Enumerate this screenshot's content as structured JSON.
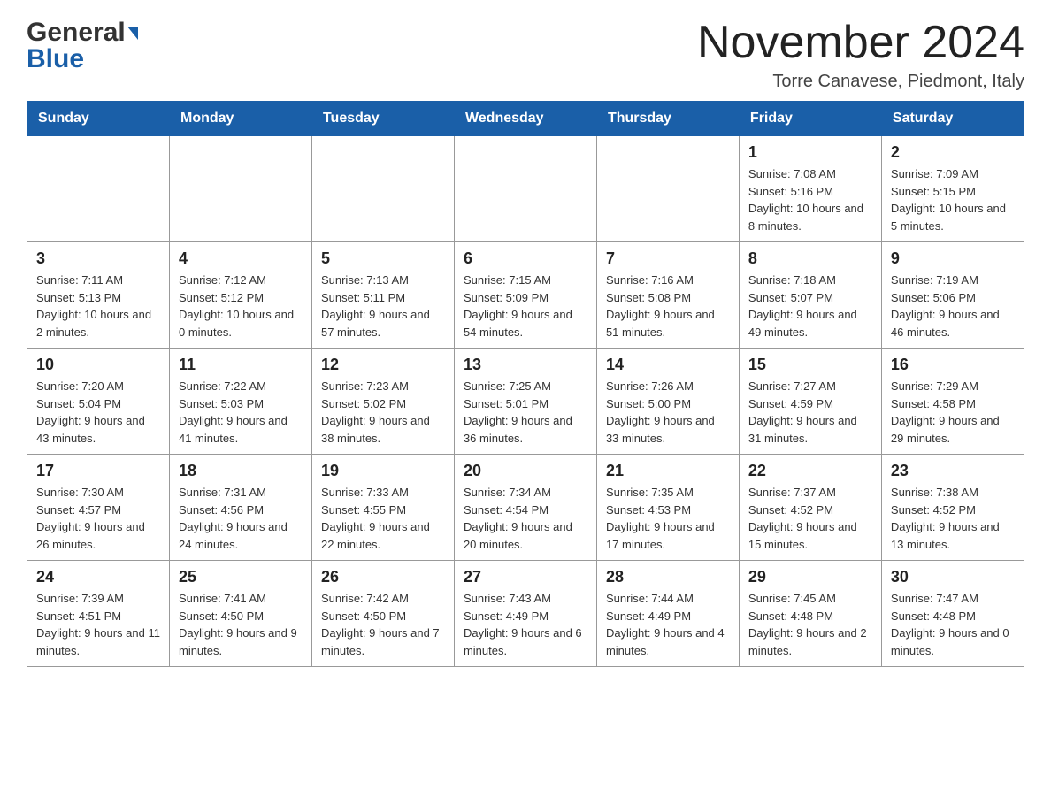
{
  "header": {
    "title": "November 2024",
    "subtitle": "Torre Canavese, Piedmont, Italy",
    "logo_line1": "General",
    "logo_line2": "Blue"
  },
  "days_of_week": [
    "Sunday",
    "Monday",
    "Tuesday",
    "Wednesday",
    "Thursday",
    "Friday",
    "Saturday"
  ],
  "weeks": [
    {
      "days": [
        {
          "number": "",
          "info": ""
        },
        {
          "number": "",
          "info": ""
        },
        {
          "number": "",
          "info": ""
        },
        {
          "number": "",
          "info": ""
        },
        {
          "number": "",
          "info": ""
        },
        {
          "number": "1",
          "info": "Sunrise: 7:08 AM\nSunset: 5:16 PM\nDaylight: 10 hours and 8 minutes."
        },
        {
          "number": "2",
          "info": "Sunrise: 7:09 AM\nSunset: 5:15 PM\nDaylight: 10 hours and 5 minutes."
        }
      ]
    },
    {
      "days": [
        {
          "number": "3",
          "info": "Sunrise: 7:11 AM\nSunset: 5:13 PM\nDaylight: 10 hours and 2 minutes."
        },
        {
          "number": "4",
          "info": "Sunrise: 7:12 AM\nSunset: 5:12 PM\nDaylight: 10 hours and 0 minutes."
        },
        {
          "number": "5",
          "info": "Sunrise: 7:13 AM\nSunset: 5:11 PM\nDaylight: 9 hours and 57 minutes."
        },
        {
          "number": "6",
          "info": "Sunrise: 7:15 AM\nSunset: 5:09 PM\nDaylight: 9 hours and 54 minutes."
        },
        {
          "number": "7",
          "info": "Sunrise: 7:16 AM\nSunset: 5:08 PM\nDaylight: 9 hours and 51 minutes."
        },
        {
          "number": "8",
          "info": "Sunrise: 7:18 AM\nSunset: 5:07 PM\nDaylight: 9 hours and 49 minutes."
        },
        {
          "number": "9",
          "info": "Sunrise: 7:19 AM\nSunset: 5:06 PM\nDaylight: 9 hours and 46 minutes."
        }
      ]
    },
    {
      "days": [
        {
          "number": "10",
          "info": "Sunrise: 7:20 AM\nSunset: 5:04 PM\nDaylight: 9 hours and 43 minutes."
        },
        {
          "number": "11",
          "info": "Sunrise: 7:22 AM\nSunset: 5:03 PM\nDaylight: 9 hours and 41 minutes."
        },
        {
          "number": "12",
          "info": "Sunrise: 7:23 AM\nSunset: 5:02 PM\nDaylight: 9 hours and 38 minutes."
        },
        {
          "number": "13",
          "info": "Sunrise: 7:25 AM\nSunset: 5:01 PM\nDaylight: 9 hours and 36 minutes."
        },
        {
          "number": "14",
          "info": "Sunrise: 7:26 AM\nSunset: 5:00 PM\nDaylight: 9 hours and 33 minutes."
        },
        {
          "number": "15",
          "info": "Sunrise: 7:27 AM\nSunset: 4:59 PM\nDaylight: 9 hours and 31 minutes."
        },
        {
          "number": "16",
          "info": "Sunrise: 7:29 AM\nSunset: 4:58 PM\nDaylight: 9 hours and 29 minutes."
        }
      ]
    },
    {
      "days": [
        {
          "number": "17",
          "info": "Sunrise: 7:30 AM\nSunset: 4:57 PM\nDaylight: 9 hours and 26 minutes."
        },
        {
          "number": "18",
          "info": "Sunrise: 7:31 AM\nSunset: 4:56 PM\nDaylight: 9 hours and 24 minutes."
        },
        {
          "number": "19",
          "info": "Sunrise: 7:33 AM\nSunset: 4:55 PM\nDaylight: 9 hours and 22 minutes."
        },
        {
          "number": "20",
          "info": "Sunrise: 7:34 AM\nSunset: 4:54 PM\nDaylight: 9 hours and 20 minutes."
        },
        {
          "number": "21",
          "info": "Sunrise: 7:35 AM\nSunset: 4:53 PM\nDaylight: 9 hours and 17 minutes."
        },
        {
          "number": "22",
          "info": "Sunrise: 7:37 AM\nSunset: 4:52 PM\nDaylight: 9 hours and 15 minutes."
        },
        {
          "number": "23",
          "info": "Sunrise: 7:38 AM\nSunset: 4:52 PM\nDaylight: 9 hours and 13 minutes."
        }
      ]
    },
    {
      "days": [
        {
          "number": "24",
          "info": "Sunrise: 7:39 AM\nSunset: 4:51 PM\nDaylight: 9 hours and 11 minutes."
        },
        {
          "number": "25",
          "info": "Sunrise: 7:41 AM\nSunset: 4:50 PM\nDaylight: 9 hours and 9 minutes."
        },
        {
          "number": "26",
          "info": "Sunrise: 7:42 AM\nSunset: 4:50 PM\nDaylight: 9 hours and 7 minutes."
        },
        {
          "number": "27",
          "info": "Sunrise: 7:43 AM\nSunset: 4:49 PM\nDaylight: 9 hours and 6 minutes."
        },
        {
          "number": "28",
          "info": "Sunrise: 7:44 AM\nSunset: 4:49 PM\nDaylight: 9 hours and 4 minutes."
        },
        {
          "number": "29",
          "info": "Sunrise: 7:45 AM\nSunset: 4:48 PM\nDaylight: 9 hours and 2 minutes."
        },
        {
          "number": "30",
          "info": "Sunrise: 7:47 AM\nSunset: 4:48 PM\nDaylight: 9 hours and 0 minutes."
        }
      ]
    }
  ]
}
